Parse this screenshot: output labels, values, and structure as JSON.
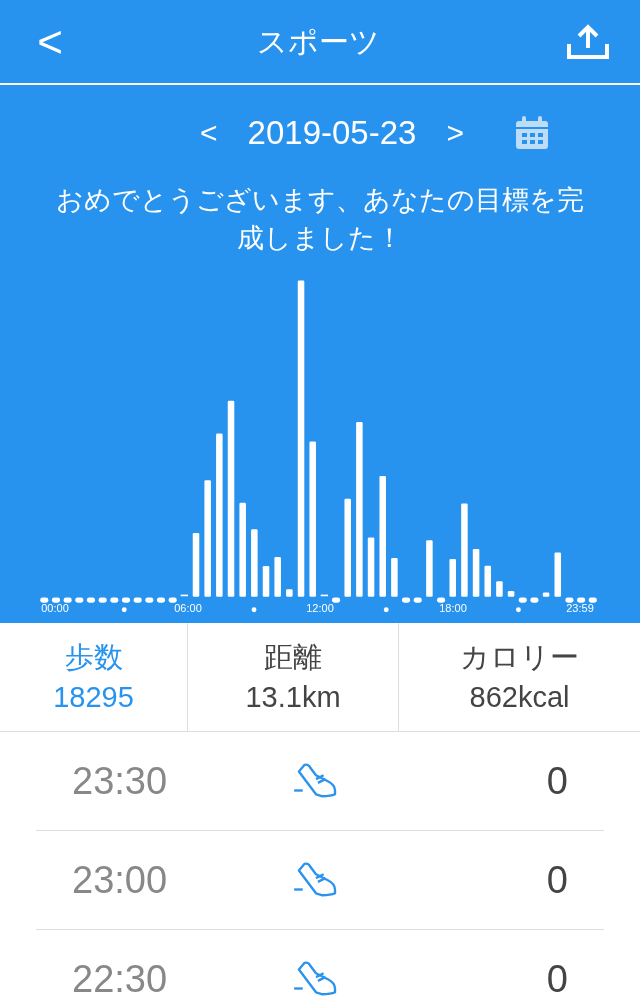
{
  "header": {
    "back": "<",
    "title": "スポーツ"
  },
  "date_nav": {
    "prev": "<",
    "date": "2019-05-23",
    "next": ">"
  },
  "message": "おめでとうございます、あなたの目標を完成しました！",
  "chart_axis_labels": [
    "00:00",
    "06:00",
    "12:00",
    "18:00",
    "23:59"
  ],
  "stats": [
    {
      "label": "歩数",
      "value": "18295",
      "selected": true
    },
    {
      "label": "距離",
      "value": "13.1km",
      "selected": false
    },
    {
      "label": "カロリー",
      "value": "862kcal",
      "selected": false
    }
  ],
  "records": [
    {
      "time": "23:30",
      "steps": "0"
    },
    {
      "time": "23:00",
      "steps": "0"
    },
    {
      "time": "22:30",
      "steps": "0"
    }
  ]
}
